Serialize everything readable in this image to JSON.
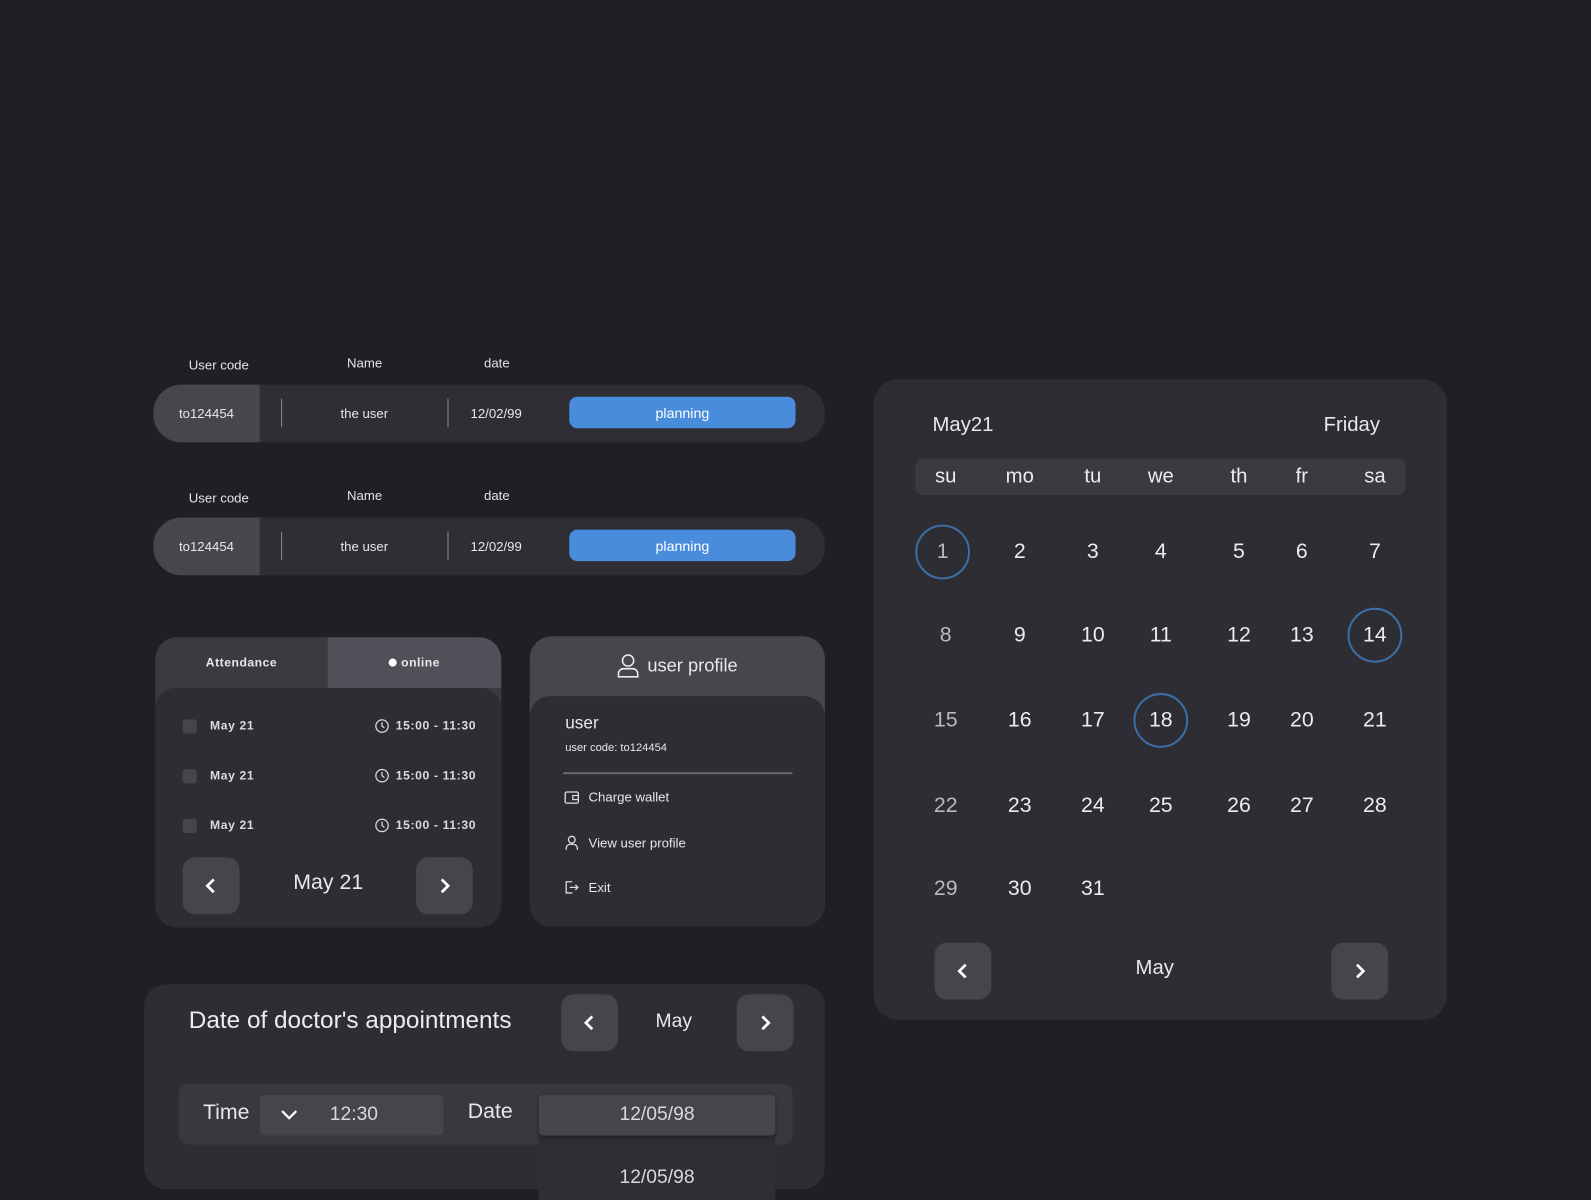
{
  "records": [
    {
      "headers": {
        "code": "User code",
        "name": "Name",
        "date": "date"
      },
      "code": "to124454",
      "name": "the user",
      "date": "12/02/99",
      "action": "planning"
    },
    {
      "headers": {
        "code": "User code",
        "name": "Name",
        "date": "date"
      },
      "code": "to124454",
      "name": "the user",
      "date": "12/02/99",
      "action": "planning"
    }
  ],
  "attendance": {
    "tab_attendance": "Attendance",
    "tab_online": "online",
    "items": [
      {
        "date": "May 21",
        "time": "15:00 - 11:30"
      },
      {
        "date": "May 21",
        "time": "15:00 - 11:30"
      },
      {
        "date": "May 21",
        "time": "15:00 - 11:30"
      }
    ],
    "current": "May 21"
  },
  "profile": {
    "title": "user profile",
    "user": "user",
    "code_label": "user code:",
    "code": "to124454",
    "menu": [
      "Charge wallet",
      "View user profile",
      "Exit"
    ]
  },
  "appointments": {
    "title": "Date of doctor's appointments",
    "month": "May",
    "time_label": "Time",
    "time_value": "12:30",
    "date_label": "Date",
    "date_value": "12/05/98",
    "dropdown_option": "12/05/98"
  },
  "calendar": {
    "title": "May21",
    "weekday_name": "Friday",
    "weekdays": [
      "su",
      "mo",
      "tu",
      "we",
      "th",
      "fr",
      "sa"
    ],
    "days": [
      1,
      2,
      3,
      4,
      5,
      6,
      7,
      8,
      9,
      10,
      11,
      12,
      13,
      14,
      15,
      16,
      17,
      18,
      19,
      20,
      21,
      22,
      23,
      24,
      25,
      26,
      27,
      28,
      29,
      30,
      31
    ],
    "marked_days": [
      1,
      14,
      18
    ],
    "month": "May",
    "accent": "#3b6fa6"
  },
  "colors": {
    "background": "#1f1f24",
    "card": "#2d2d33",
    "button": "#4a8cdc"
  }
}
